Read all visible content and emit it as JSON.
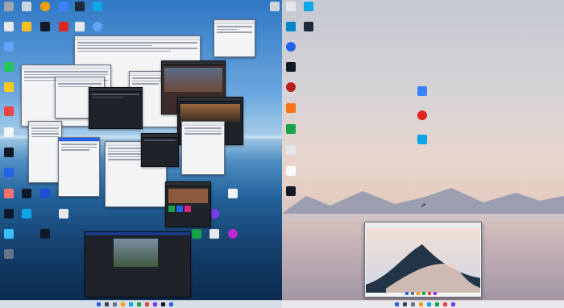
{
  "left_monitor": {
    "taskbar": {
      "tray_text": ""
    }
  },
  "right_monitor": {
    "mini_window": {
      "title": ""
    }
  },
  "icons": [
    "app-icon",
    "app-icon",
    "chrome-icon",
    "app-icon",
    "app-icon",
    "trash-icon",
    "app-icon",
    "app-icon",
    "app-icon",
    "app-icon",
    "app-icon",
    "app-icon",
    "app-icon",
    "app-icon",
    "app-icon",
    "app-icon",
    "app-icon",
    "app-icon",
    "app-icon",
    "app-icon",
    "app-icon",
    "app-icon",
    "app-icon",
    "app-icon",
    "app-icon",
    "app-icon",
    "app-icon"
  ]
}
